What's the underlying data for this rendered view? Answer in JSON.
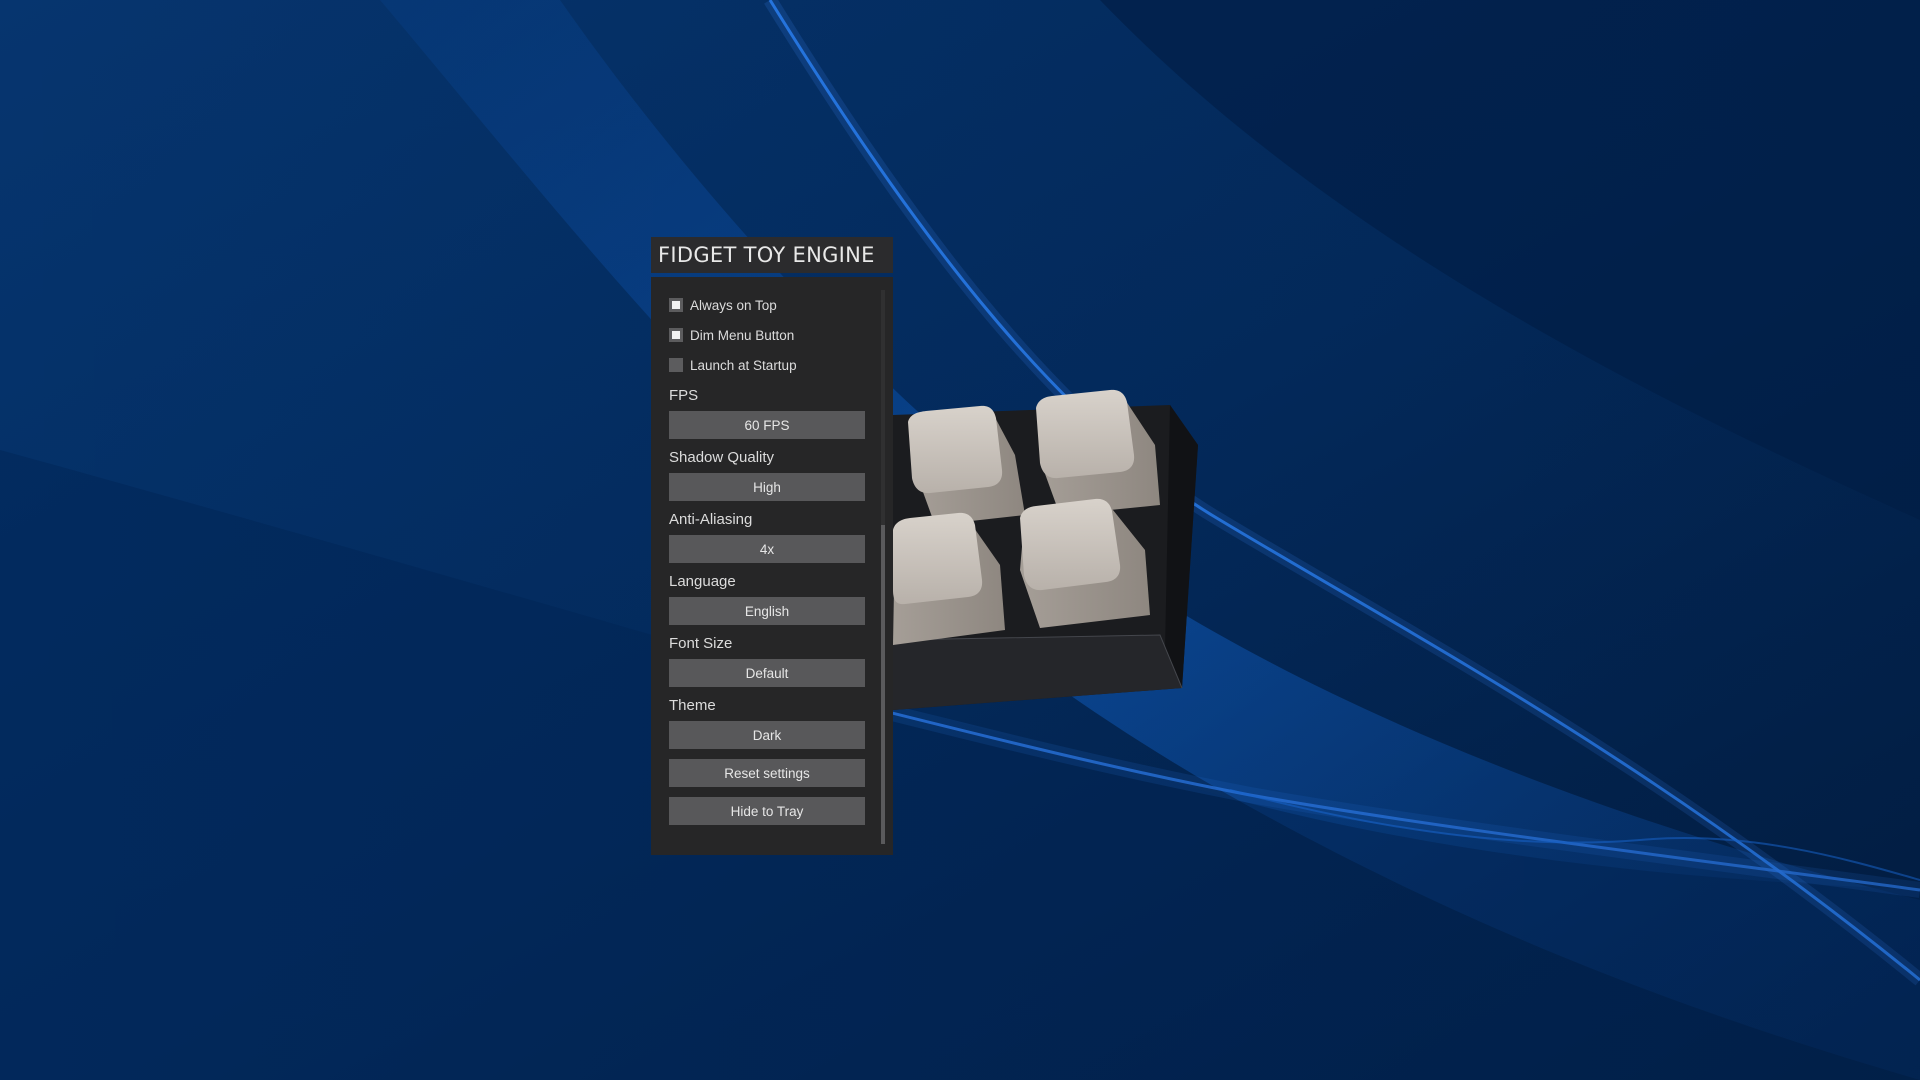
{
  "app": {
    "title": "FIDGET TOY ENGINE"
  },
  "settings": {
    "checkboxes": [
      {
        "label": "Always on Top",
        "checked": true
      },
      {
        "label": "Dim Menu Button",
        "checked": true
      },
      {
        "label": "Launch at Startup",
        "checked": false
      }
    ],
    "fps": {
      "label": "FPS",
      "value": "60 FPS"
    },
    "shadow_quality": {
      "label": "Shadow Quality",
      "value": "High"
    },
    "anti_aliasing": {
      "label": "Anti-Aliasing",
      "value": "4x"
    },
    "language": {
      "label": "Language",
      "value": "English"
    },
    "font_size": {
      "label": "Font Size",
      "value": "Default"
    },
    "theme": {
      "label": "Theme",
      "value": "Dark"
    },
    "reset_label": "Reset settings",
    "hide_label": "Hide to Tray"
  },
  "colors": {
    "desktop_background": "#03244f",
    "wave_accent": "#1a6ee0",
    "panel_background": "#262627",
    "control_background": "#58585a",
    "keycap": "#cdc6bf",
    "keypad_body": "#1e1f22"
  },
  "icons": {
    "checkbox_checked": "checkbox-checked-icon",
    "checkbox_unchecked": "checkbox-unchecked-icon"
  }
}
